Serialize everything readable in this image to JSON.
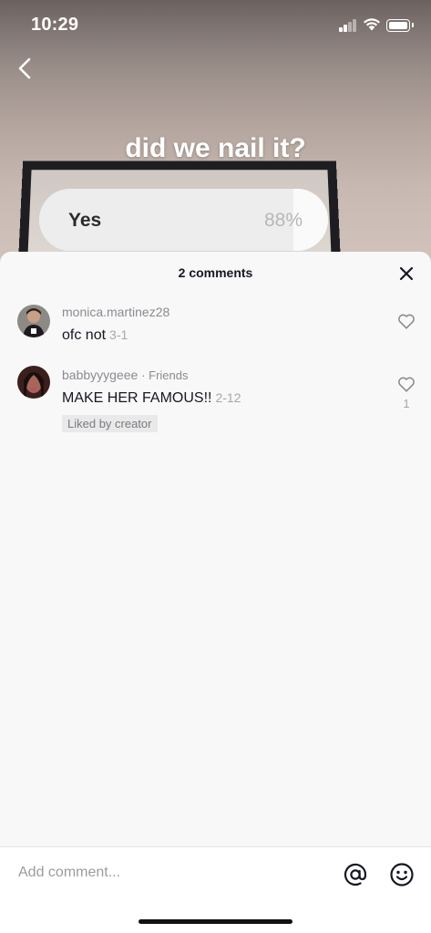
{
  "status_bar": {
    "time": "10:29"
  },
  "poll": {
    "question": "did we nail it?",
    "option_label": "Yes",
    "option_percent_text": "88%",
    "option_fraction": 0.88
  },
  "comments_sheet": {
    "title": "2 comments",
    "comments": [
      {
        "username": "monica.martinez28",
        "tag": "",
        "text": "ofc not",
        "date": "3-1",
        "likes": "",
        "badge": ""
      },
      {
        "username": "babbyyygeee",
        "tag": "· Friends",
        "text": "MAKE HER FAMOUS!!",
        "date": "2-12",
        "likes": "1",
        "badge": "Liked by creator"
      }
    ]
  },
  "input_bar": {
    "placeholder": "Add comment..."
  },
  "colors": {
    "sheet_bg": "#f8f8f8",
    "text_primary": "#161823",
    "text_secondary": "#8a8b91"
  },
  "icons": {
    "back": "chevron-left-icon",
    "close": "close-icon",
    "like": "heart-outline-icon",
    "mention": "at-icon",
    "emoji": "smiley-icon"
  }
}
